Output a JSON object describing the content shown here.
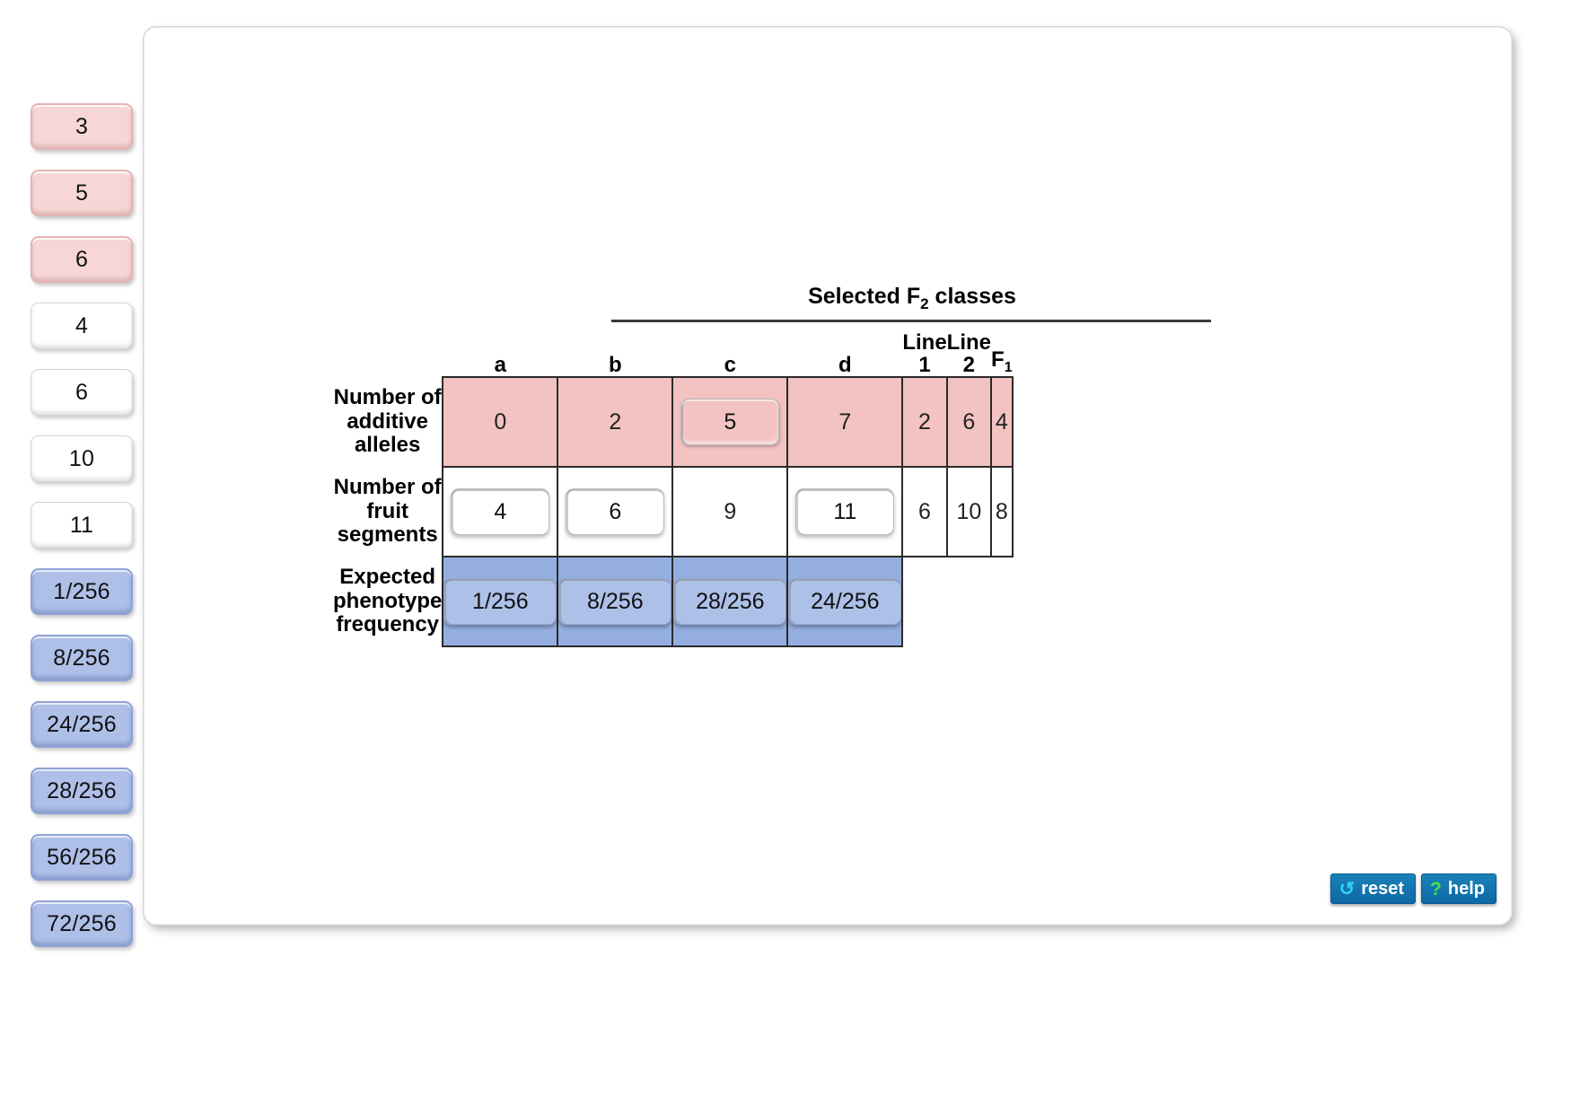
{
  "tray": {
    "tiles": [
      {
        "label": "3",
        "style": "pink"
      },
      {
        "label": "5",
        "style": "pink"
      },
      {
        "label": "6",
        "style": "pink"
      },
      {
        "label": "4",
        "style": "white"
      },
      {
        "label": "6",
        "style": "white"
      },
      {
        "label": "10",
        "style": "white"
      },
      {
        "label": "11",
        "style": "white"
      },
      {
        "label": "1/256",
        "style": "blue"
      },
      {
        "label": "8/256",
        "style": "blue"
      },
      {
        "label": "24/256",
        "style": "blue"
      },
      {
        "label": "28/256",
        "style": "blue"
      },
      {
        "label": "56/256",
        "style": "blue"
      },
      {
        "label": "72/256",
        "style": "blue"
      }
    ]
  },
  "table": {
    "group_header": "Selected F",
    "group_header_sub": "2",
    "group_header_tail": " classes",
    "columns": [
      {
        "label": "a",
        "sub": "",
        "group": "f2"
      },
      {
        "label": "b",
        "sub": "",
        "group": "f2"
      },
      {
        "label": "c",
        "sub": "",
        "group": "f2"
      },
      {
        "label": "d",
        "sub": "",
        "group": "f2"
      },
      {
        "label": "Line 1",
        "sub": "",
        "group": "other"
      },
      {
        "label": "Line 2",
        "sub": "",
        "group": "other"
      },
      {
        "label": "F",
        "sub": "1",
        "group": "other"
      }
    ],
    "rows": [
      {
        "label": "Number of additive alleles",
        "fill": "pinkrow",
        "cells": [
          {
            "value": "0",
            "slot": false
          },
          {
            "value": "2",
            "slot": false
          },
          {
            "value": "5",
            "slot": true,
            "slot_style": "pink"
          },
          {
            "value": "7",
            "slot": false
          },
          {
            "value": "2",
            "slot": false
          },
          {
            "value": "6",
            "slot": false
          },
          {
            "value": "4",
            "slot": false
          }
        ]
      },
      {
        "label": "Number of fruit segments",
        "fill": "whiterow",
        "cells": [
          {
            "value": "4",
            "slot": true,
            "slot_style": "white"
          },
          {
            "value": "6",
            "slot": true,
            "slot_style": "white"
          },
          {
            "value": "9",
            "slot": false
          },
          {
            "value": "11",
            "slot": true,
            "slot_style": "white"
          },
          {
            "value": "6",
            "slot": false
          },
          {
            "value": "10",
            "slot": false
          },
          {
            "value": "8",
            "slot": false
          }
        ]
      },
      {
        "label": "Expected phenotype frequency",
        "fill": "bluerow",
        "cells": [
          {
            "value": "1/256",
            "slot": true,
            "slot_style": "blue"
          },
          {
            "value": "8/256",
            "slot": true,
            "slot_style": "blue"
          },
          {
            "value": "28/256",
            "slot": true,
            "slot_style": "blue"
          },
          {
            "value": "24/256",
            "slot": true,
            "slot_style": "blue"
          },
          {
            "value": "",
            "slot": false,
            "blank": true
          },
          {
            "value": "",
            "slot": false,
            "blank": true
          },
          {
            "value": "",
            "slot": false,
            "blank": true
          }
        ]
      }
    ]
  },
  "footer": {
    "reset_label": "reset",
    "reset_icon": "↺",
    "help_label": "help",
    "help_icon": "?"
  },
  "colors": {
    "pink_fill": "#f2c3c2",
    "blue_fill": "#94aee0",
    "tile_pink": "#f7d7d6",
    "tile_blue": "#aebfe8",
    "button_blue": "#0d68a4"
  }
}
